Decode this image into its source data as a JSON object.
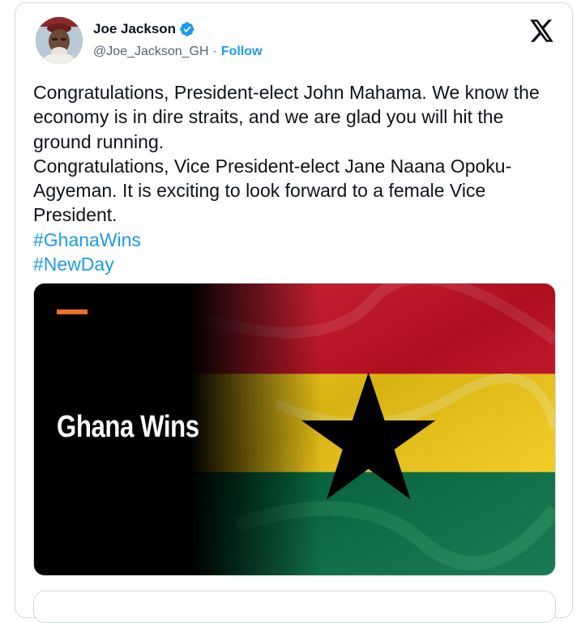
{
  "author": {
    "display_name": "Joe Jackson",
    "handle": "@Joe_Jackson_GH",
    "separator": "·",
    "follow_label": "Follow",
    "verified_color": "#1d9bf0"
  },
  "tweet": {
    "paragraph_1": "Congratulations, President-elect John Mahama. We know the economy is in dire straits, and we are glad you will hit the ground running.",
    "paragraph_2": "Congratulations, Vice President-elect Jane Naana Opoku-Agyeman. It is exciting to look forward to a female Vice President.",
    "hashtags": [
      "#GhanaWins",
      "#NewDay"
    ]
  },
  "media": {
    "title": "Ghana Wins",
    "flag_colors": {
      "red": "#ce1126",
      "gold": "#fcd116",
      "green": "#006b3f",
      "star": "#000000"
    },
    "accent_color": "#ee6f2d"
  },
  "icons": {
    "x_logo": "x-logo-icon",
    "verified": "verified-badge-icon",
    "avatar": "avatar-photo"
  }
}
